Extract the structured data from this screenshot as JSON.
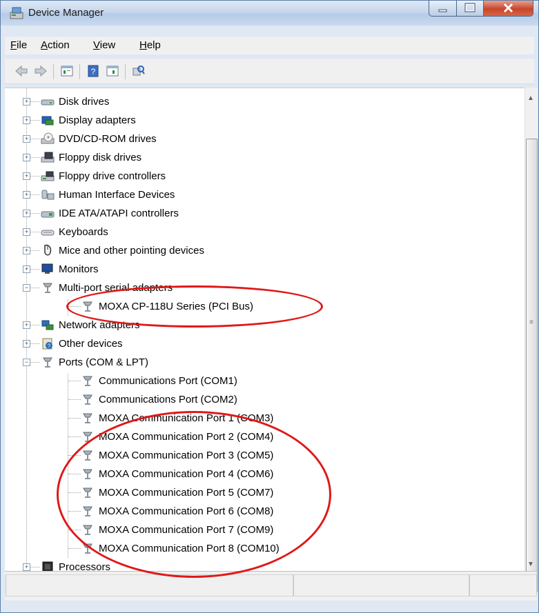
{
  "window": {
    "title": "Device Manager"
  },
  "menu": [
    "File",
    "Action",
    "View",
    "Help"
  ],
  "toolbar": [
    "back-icon",
    "forward-icon",
    "properties-icon",
    "help-icon",
    "update-icon",
    "scan-hardware-icon"
  ],
  "tree": [
    {
      "label": "Disk drives",
      "icon": "disk-drive-icon",
      "level": 1,
      "expander": "+"
    },
    {
      "label": "Display adapters",
      "icon": "display-adapter-icon",
      "level": 1,
      "expander": "+"
    },
    {
      "label": "DVD/CD-ROM drives",
      "icon": "dvd-drive-icon",
      "level": 1,
      "expander": "+"
    },
    {
      "label": "Floppy disk drives",
      "icon": "floppy-drive-icon",
      "level": 1,
      "expander": "+"
    },
    {
      "label": "Floppy drive controllers",
      "icon": "floppy-controller-icon",
      "level": 1,
      "expander": "+"
    },
    {
      "label": "Human Interface Devices",
      "icon": "hid-icon",
      "level": 1,
      "expander": "+"
    },
    {
      "label": "IDE ATA/ATAPI controllers",
      "icon": "ide-controller-icon",
      "level": 1,
      "expander": "+"
    },
    {
      "label": "Keyboards",
      "icon": "keyboard-icon",
      "level": 1,
      "expander": "+"
    },
    {
      "label": "Mice and other pointing devices",
      "icon": "mouse-icon",
      "level": 1,
      "expander": "+"
    },
    {
      "label": "Monitors",
      "icon": "monitor-icon",
      "level": 1,
      "expander": "+"
    },
    {
      "label": "Multi-port serial adapters",
      "icon": "serial-port-icon",
      "level": 1,
      "expander": "-"
    },
    {
      "label": "MOXA CP-118U Series (PCI Bus)",
      "icon": "serial-port-icon",
      "level": 2
    },
    {
      "label": "Network adapters",
      "icon": "network-adapter-icon",
      "level": 1,
      "expander": "+"
    },
    {
      "label": "Other devices",
      "icon": "unknown-device-icon",
      "level": 1,
      "expander": "+"
    },
    {
      "label": "Ports (COM & LPT)",
      "icon": "serial-port-icon",
      "level": 1,
      "expander": "-"
    },
    {
      "label": "Communications Port (COM1)",
      "icon": "serial-port-icon",
      "level": 2
    },
    {
      "label": "Communications Port (COM2)",
      "icon": "serial-port-icon",
      "level": 2
    },
    {
      "label": "MOXA Communication Port 1 (COM3)",
      "icon": "serial-port-icon",
      "level": 2
    },
    {
      "label": "MOXA Communication Port 2 (COM4)",
      "icon": "serial-port-icon",
      "level": 2
    },
    {
      "label": "MOXA Communication Port 3 (COM5)",
      "icon": "serial-port-icon",
      "level": 2
    },
    {
      "label": "MOXA Communication Port 4 (COM6)",
      "icon": "serial-port-icon",
      "level": 2
    },
    {
      "label": "MOXA Communication Port 5 (COM7)",
      "icon": "serial-port-icon",
      "level": 2
    },
    {
      "label": "MOXA Communication Port 6 (COM8)",
      "icon": "serial-port-icon",
      "level": 2
    },
    {
      "label": "MOXA Communication Port 7 (COM9)",
      "icon": "serial-port-icon",
      "level": 2
    },
    {
      "label": "MOXA Communication Port 8 (COM10)",
      "icon": "serial-port-icon",
      "level": 2
    },
    {
      "label": "Processors",
      "icon": "processor-icon",
      "level": 1,
      "expander": "+"
    }
  ],
  "colors": {
    "highlight_ellipse": "#e01818"
  }
}
